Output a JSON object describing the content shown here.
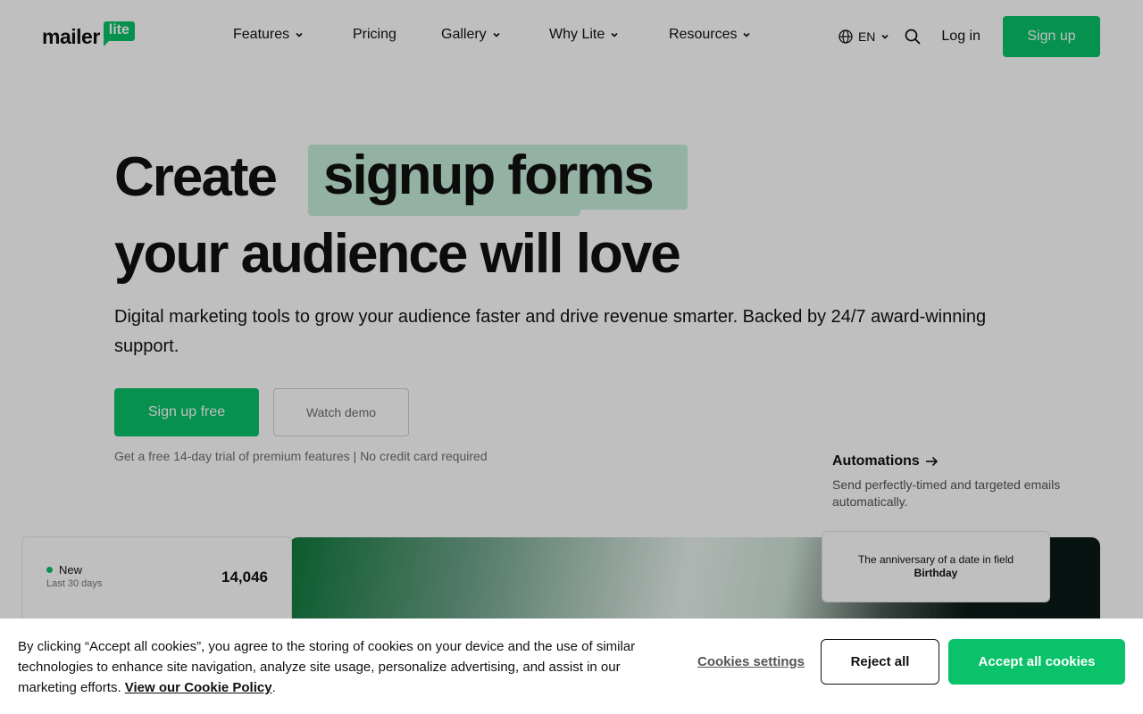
{
  "brand": {
    "word": "mailer",
    "badge": "lite",
    "accent_color": "#09c269"
  },
  "nav": {
    "items": [
      {
        "label": "Features",
        "has_dropdown": true
      },
      {
        "label": "Pricing",
        "has_dropdown": false
      },
      {
        "label": "Gallery",
        "has_dropdown": true
      },
      {
        "label": "Why Lite",
        "has_dropdown": true
      },
      {
        "label": "Resources",
        "has_dropdown": true
      }
    ],
    "language": "EN",
    "login": "Log in",
    "signup": "Sign up"
  },
  "hero": {
    "title_word1": "Create",
    "title_highlight": "signup forms",
    "title_line2": "your audience will love",
    "highlight_color": "#c6eedb",
    "subtitle": "Digital marketing tools to grow your audience faster and drive revenue smarter. Backed by 24/7 award-winning support.",
    "cta_primary": "Sign up free",
    "cta_secondary": "Watch demo",
    "trial_note": "Get a free 14-day trial of premium features | No credit card required"
  },
  "feature": {
    "link": "Automations",
    "description": "Send perfectly-timed and targeted emails automatically."
  },
  "stat_card": {
    "label": "New",
    "sub": "Last 30 days",
    "value": "14,046"
  },
  "trigger_card": {
    "text": "The anniversary of a date in field",
    "field": "Birthday"
  },
  "cookie_banner": {
    "text": "By clicking “Accept all cookies”, you agree to the storing of cookies on your device and the use of similar technologies to enhance site navigation, analyze site usage, personalize advertising, and assist in our marketing efforts.",
    "policy_link": "View our Cookie Policy",
    "settings": "Cookies settings",
    "reject": "Reject all",
    "accept": "Accept all cookies"
  }
}
